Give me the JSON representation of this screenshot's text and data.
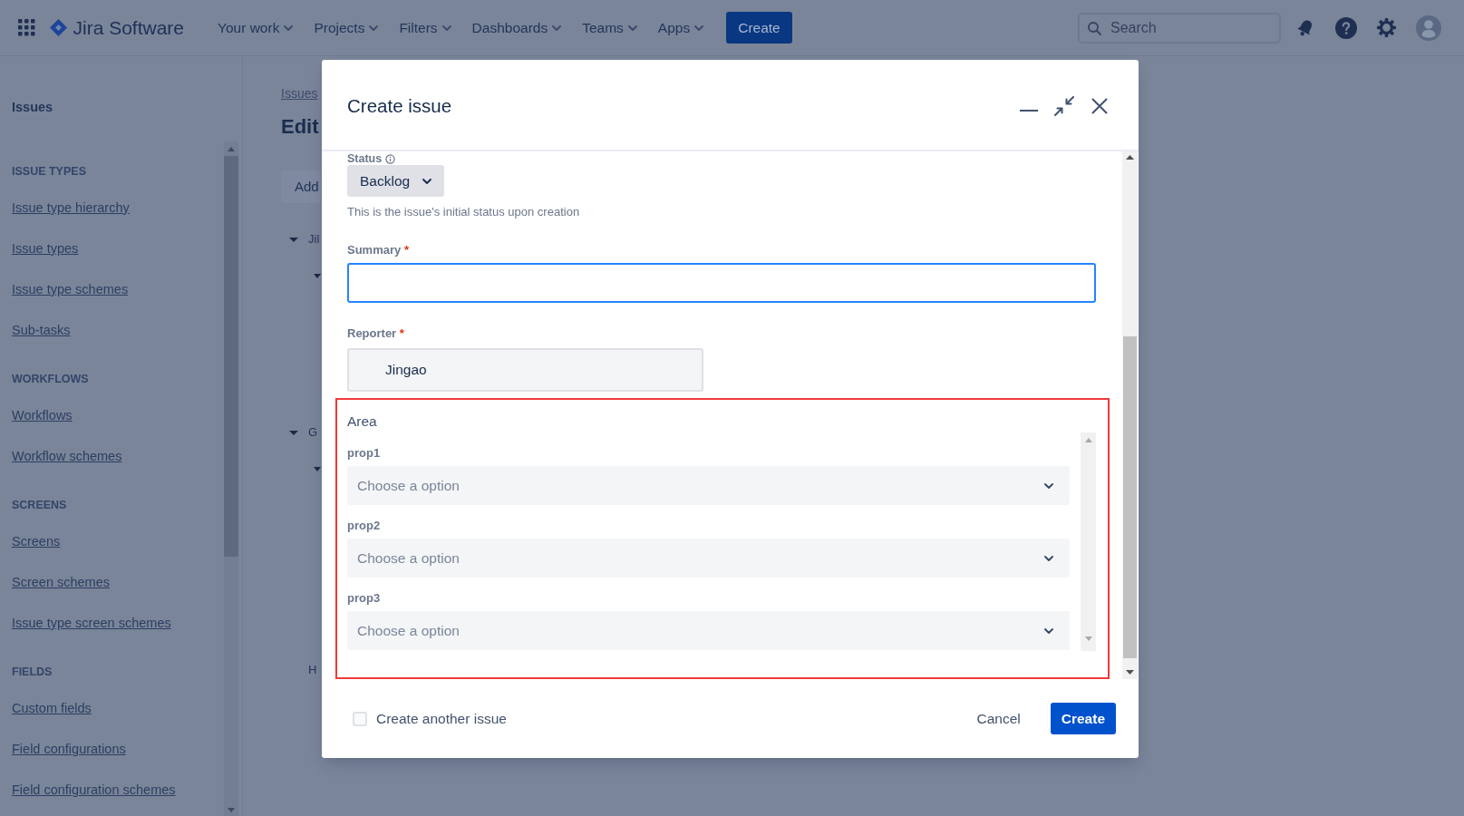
{
  "top_nav": {
    "app_name": "Jira Software",
    "menus": [
      {
        "label": "Your work"
      },
      {
        "label": "Projects"
      },
      {
        "label": "Filters"
      },
      {
        "label": "Dashboards"
      },
      {
        "label": "Teams"
      },
      {
        "label": "Apps"
      }
    ],
    "create_button": "Create",
    "search": {
      "placeholder": "Search"
    }
  },
  "sidebar": {
    "title": "Issues",
    "sections": [
      {
        "heading": "ISSUE TYPES",
        "items": [
          "Issue type hierarchy",
          "Issue types",
          "Issue type schemes",
          "Sub-tasks"
        ]
      },
      {
        "heading": "WORKFLOWS",
        "items": [
          "Workflows",
          "Workflow schemes"
        ]
      },
      {
        "heading": "SCREENS",
        "items": [
          "Screens",
          "Screen schemes",
          "Issue type screen schemes"
        ]
      },
      {
        "heading": "FIELDS",
        "items": [
          "Custom fields",
          "Field configurations",
          "Field configuration schemes"
        ]
      }
    ]
  },
  "page": {
    "breadcrumb": "Issues",
    "title": "Edit",
    "button": "Add",
    "tree": [
      {
        "kind": "node",
        "label": "Jil",
        "expanded": true,
        "children": [
          {
            "kind": "node",
            "expanded": true
          }
        ]
      },
      {
        "kind": "node",
        "label": "G",
        "expanded": true,
        "children": [
          {
            "kind": "node",
            "expanded": true
          }
        ]
      },
      {
        "kind": "label",
        "label": "H"
      }
    ]
  },
  "modal": {
    "title": "Create issue",
    "status": {
      "label": "Status",
      "value": "Backlog",
      "help": "This is the issue's initial status upon creation"
    },
    "summary": {
      "label": "Summary",
      "required_mark": "*",
      "focused": true
    },
    "reporter": {
      "label": "Reporter",
      "required_mark": "*",
      "value": "Jingao"
    },
    "area": {
      "label": "Area",
      "highlighted": true,
      "fields": [
        {
          "label": "prop1",
          "placeholder": "Choose a option"
        },
        {
          "label": "prop2",
          "placeholder": "Choose a option"
        },
        {
          "label": "prop3",
          "placeholder": "Choose a option"
        }
      ]
    },
    "create_another": {
      "label": "Create another issue",
      "checked": false
    },
    "buttons": [
      {
        "label": "Cancel",
        "kind": "subtle"
      },
      {
        "label": "Create",
        "kind": "primary"
      }
    ]
  }
}
